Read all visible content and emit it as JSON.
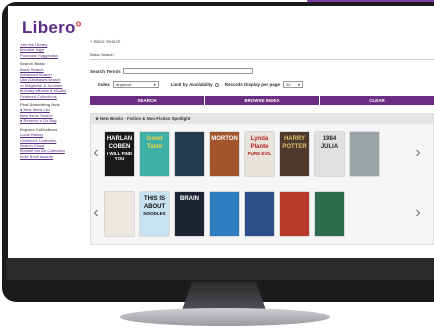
{
  "app": {
    "logo": "Libero",
    "logo_mark": "o"
  },
  "breadcrumb": "> Basic Search",
  "tab_label": "Basic Search",
  "sidebar": {
    "links_top": [
      "Join the Library",
      "Member login",
      "Purchase Suggestion"
    ],
    "section1": "Search Basic",
    "links1": [
      "Basic Search",
      "Advanced Search",
      "Use Databases search",
      "Magazine & Journals",
      "eLibrary eBooks & eAudio",
      "Featured Collections"
    ],
    "section2": "Find Something New",
    "links2": [
      "New Items List",
      "New Items Search",
      "Reserve a Go Bag"
    ],
    "section3": "Explore Collections",
    "links3": [
      "Local History",
      "Children's Collection",
      "Search Cloud",
      "Browse our Art Collection",
      "Indie Book Awards"
    ]
  },
  "search": {
    "label": "Search Term/s",
    "value": ""
  },
  "filters": {
    "index_label": "Index",
    "index_value": "Anyword",
    "limit_label": "Limit by Availability",
    "records_label": "Records Display per page",
    "records_value": "20"
  },
  "buttons": {
    "search": "SEARCH",
    "browse": "BROWSE INDEX",
    "clear": "CLEAR"
  },
  "panel": {
    "title": "New Books - Fiction & Non-Fiction Spotlight"
  },
  "books_row1": [
    {
      "l1": "HARLAN",
      "l2": "COBEN",
      "l3": "I WILL FIND YOU",
      "bg": "#1a1a1a",
      "fg": "#ffffff"
    },
    {
      "l1": "Good",
      "l2": "Taste",
      "l3": "",
      "bg": "#3fb1a7",
      "fg": "#f5d34a"
    },
    {
      "l1": "",
      "l2": "",
      "l3": "",
      "bg": "#243a4d",
      "fg": "#ffffff"
    },
    {
      "l1": "",
      "l2": "MORTON",
      "l3": "",
      "bg": "#a2542a",
      "fg": "#ffffff"
    },
    {
      "l1": "Lynda",
      "l2": "Plante",
      "l3": "PURE EVIL",
      "bg": "#e8e4dc",
      "fg": "#b51f1f"
    },
    {
      "l1": "HARRY",
      "l2": "POTTER",
      "l3": "",
      "bg": "#4d3a2c",
      "fg": "#e0c070"
    },
    {
      "l1": "1984",
      "l2": "JULIA",
      "l3": "",
      "bg": "#e0e0e0",
      "fg": "#222222"
    },
    {
      "l1": "",
      "l2": "",
      "l3": "",
      "bg": "#9aa5a8",
      "fg": "#ffffff"
    }
  ],
  "books_row2": [
    {
      "l1": "",
      "l2": "",
      "l3": "",
      "bg": "#ede9e0",
      "fg": "#333333"
    },
    {
      "l1": "THIS IS",
      "l2": "ABOUT",
      "l3": "NOODLES",
      "bg": "#c7e3f0",
      "fg": "#111111"
    },
    {
      "l1": "",
      "l2": "BRAIN",
      "l3": "",
      "bg": "#1d2433",
      "fg": "#ffffff"
    },
    {
      "l1": "",
      "l2": "",
      "l3": "",
      "bg": "#2f7fc0",
      "fg": "#ffffff"
    },
    {
      "l1": "",
      "l2": "",
      "l3": "",
      "bg": "#2c4f8a",
      "fg": "#ffffff"
    },
    {
      "l1": "",
      "l2": "",
      "l3": "",
      "bg": "#b83a2a",
      "fg": "#ffffff"
    },
    {
      "l1": "",
      "l2": "",
      "l3": "",
      "bg": "#2f6b4f",
      "fg": "#ffffff"
    }
  ]
}
